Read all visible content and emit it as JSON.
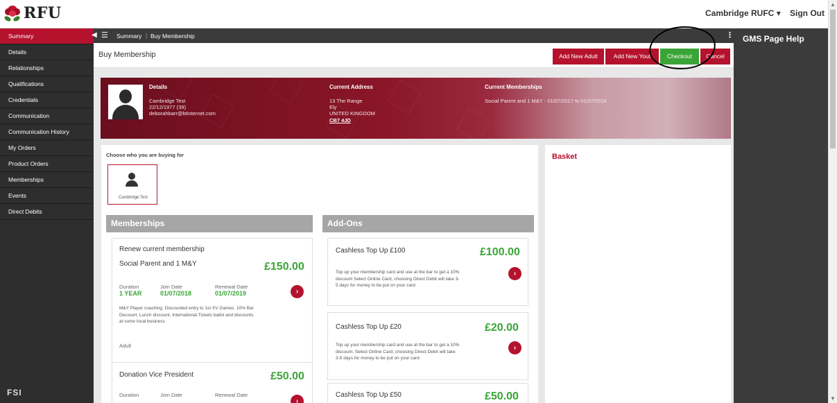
{
  "header": {
    "logo_text": "RFU",
    "club": "Cambridge RUFC",
    "club_caret": "▾",
    "sign_out": "Sign Out"
  },
  "sidebar": {
    "items": [
      {
        "label": "Summary"
      },
      {
        "label": "Details"
      },
      {
        "label": "Relationships"
      },
      {
        "label": "Qualifications"
      },
      {
        "label": "Credentials"
      },
      {
        "label": "Communication"
      },
      {
        "label": "Communication History"
      },
      {
        "label": "My Orders"
      },
      {
        "label": "Product Orders"
      },
      {
        "label": "Memberships"
      },
      {
        "label": "Events"
      },
      {
        "label": "Direct Debits"
      }
    ],
    "footer_logo": "FSI"
  },
  "breadcrumb": {
    "items": [
      "Summary",
      "Buy Membership"
    ]
  },
  "help": {
    "title": "GMS Page Help"
  },
  "page": {
    "title": "Buy Membership",
    "buttons": {
      "add_adult": "Add New Adult",
      "add_youth": "Add New Yout",
      "checkout": "Checkout",
      "cancel": "Cancel"
    }
  },
  "profile": {
    "details_label": "Details",
    "name": "Cambridge Test",
    "dob": "22/12/1977 (39)",
    "email": "deborahbarr@btinternet.com",
    "address_label": "Current Address",
    "address_line1": "13 The Range",
    "address_line2": "Ely",
    "address_line3": "UNITED KINGDOM",
    "postcode": "CB7 4JD",
    "memberships_label": "Current Memberships",
    "current_membership": "Social Parent and 1 M&Y - 01/07/2017 to 01/07/2018"
  },
  "choose": {
    "label": "Choose who you are buying for",
    "person": "Cambridge Test"
  },
  "memberships": {
    "heading": "Memberships",
    "cards": [
      {
        "group": "Renew current membership",
        "name": "Social Parent and 1 M&Y",
        "price": "£150.00",
        "duration_label": "Duration",
        "duration": "1 YEAR",
        "join_label": "Join Date",
        "join": "01/07/2018",
        "renewal_label": "Renewal Date",
        "renewal": "01/07/2019",
        "description": "M&Y Player coaching. Discounted entry to 1st XV Games. 10% Bar Discount. Lunch discount, International Tickets ballot and discounts at some local business",
        "type": "Adult"
      },
      {
        "name": "Donation Vice President",
        "price": "£50.00",
        "duration_label": "Duration",
        "join_label": "Join Date",
        "renewal_label": "Renewal Date"
      }
    ]
  },
  "addons": {
    "heading": "Add-Ons",
    "cards": [
      {
        "name": "Cashless Top Up £100",
        "price": "£100.00",
        "description": "Top up your membership card and use at the bar to get a 10% discount Select Online Card, choosing Direct Debit will take 3-5 days for money to be put on your card"
      },
      {
        "name": "Cashless Top Up £20",
        "price": "£20.00",
        "description": "Top up your membership card and use at the bar to get a 10% discount. Select Online Card, choosing Direct Debit will take 3-5 days for money to be put on your card"
      },
      {
        "name": "Cashless Top Up £50",
        "price": "£50.00"
      }
    ]
  },
  "basket": {
    "title": "Basket"
  },
  "colors": {
    "brand_red": "#b5122d",
    "checkout_green": "#3aa536",
    "sidebar_dark": "#2e2e2e"
  }
}
